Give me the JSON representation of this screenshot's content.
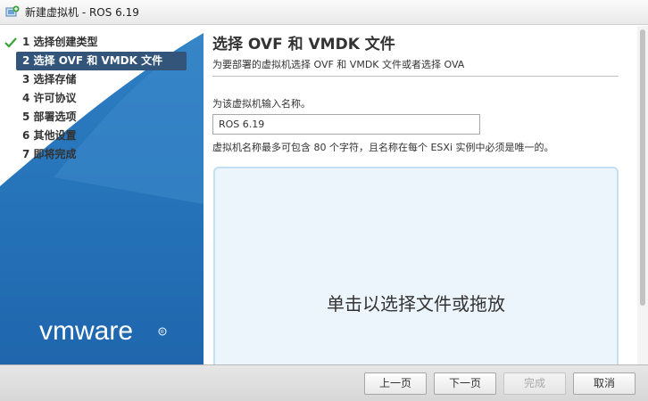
{
  "window": {
    "title": "新建虚拟机 - ROS 6.19",
    "icon": "new-vm-icon"
  },
  "sidebar": {
    "steps": [
      {
        "label": "1 选择创建类型",
        "state": "completed"
      },
      {
        "label": "2 选择 OVF 和 VMDK 文件",
        "state": "current"
      },
      {
        "label": "3 选择存储",
        "state": "pending"
      },
      {
        "label": "4 许可协议",
        "state": "pending"
      },
      {
        "label": "5 部署选项",
        "state": "pending"
      },
      {
        "label": "6 其他设置",
        "state": "pending"
      },
      {
        "label": "7 即将完成",
        "state": "pending"
      }
    ],
    "logo_text": "vmware"
  },
  "main": {
    "heading": "选择 OVF 和 VMDK 文件",
    "subheading": "为要部署的虚拟机选择 OVF 和 VMDK 文件或者选择 OVA",
    "name_label": "为该虚拟机输入名称。",
    "name_value": "ROS 6.19",
    "name_hint": "虚拟机名称最多可包含 80 个字符，且名称在每个 ESXi 实例中必须是唯一的。",
    "dropzone_text": "单击以选择文件或拖放"
  },
  "footer": {
    "back_label": "上一页",
    "next_label": "下一页",
    "finish_label": "完成",
    "cancel_label": "取消"
  },
  "colors": {
    "sidebar_blue": "#2572b8",
    "active_step": "#33557a",
    "dropzone_fill": "#edf5fc",
    "dropzone_border": "#c3dff3",
    "check_green": "#3aa13a"
  }
}
